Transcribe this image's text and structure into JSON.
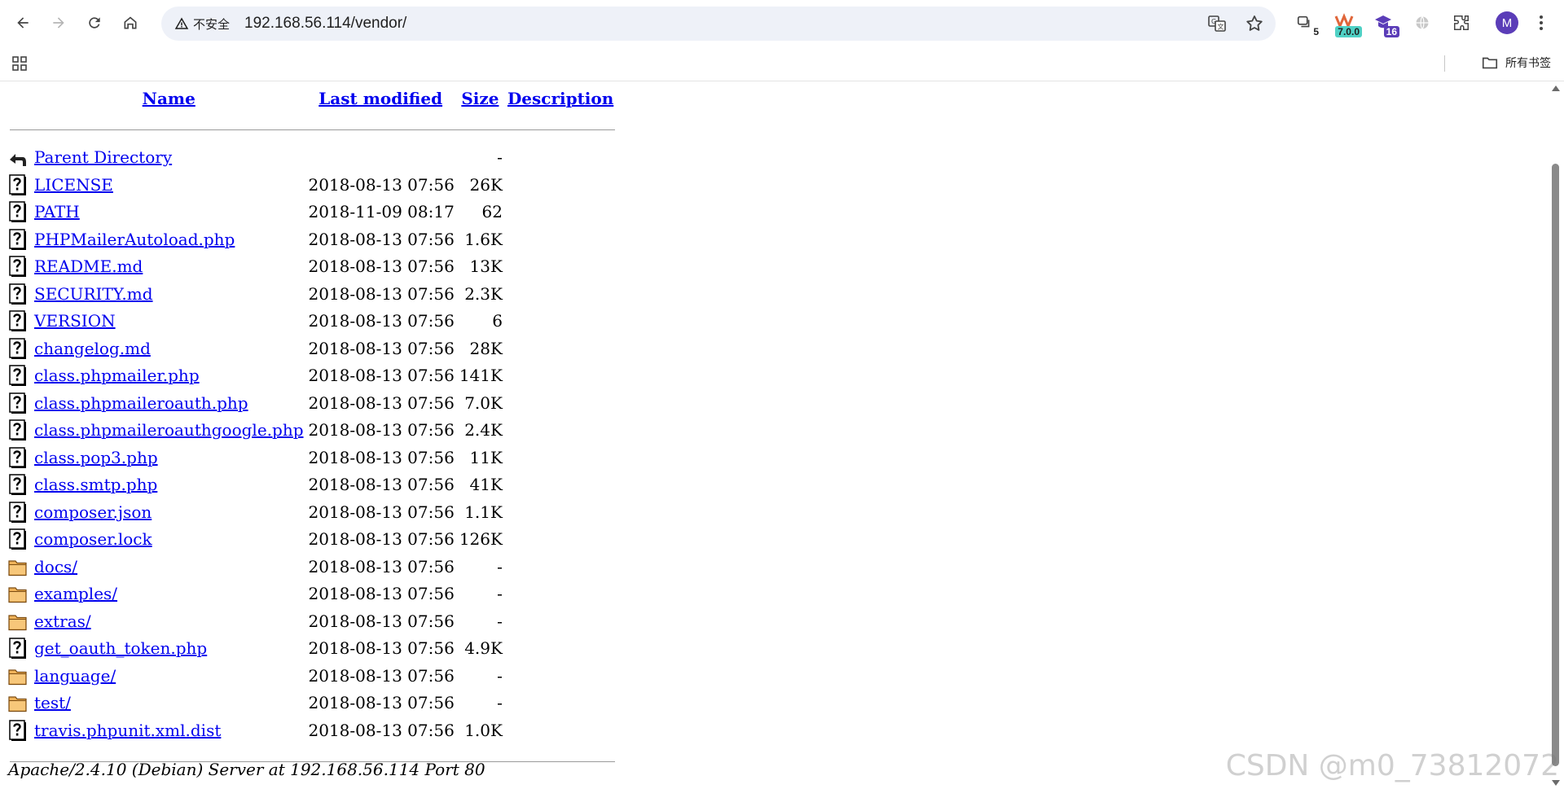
{
  "browser": {
    "security_label": "不安全",
    "url": "192.168.56.114/vendor/",
    "avatar_letter": "M",
    "bookmarks_label": "所有书签",
    "extensions": [
      {
        "icon": "tab-counter-icon",
        "badge": "5",
        "badge_color": "#1f1f1f"
      },
      {
        "icon": "wappalyzer-like-icon",
        "badge": "7.0.0",
        "badge_color": "#1b8f8a"
      },
      {
        "icon": "hat-icon",
        "badge": "16",
        "badge_color": "#5b3db8"
      },
      {
        "icon": "globe-icon",
        "badge": "",
        "badge_color": ""
      }
    ]
  },
  "listing": {
    "headers": {
      "name": "Name",
      "modified": "Last modified",
      "size": "Size",
      "description": "Description"
    },
    "rows": [
      {
        "icon": "parent-directory-icon",
        "name": "Parent Directory",
        "modified": "",
        "size": "-"
      },
      {
        "icon": "unknown-file-icon",
        "name": "LICENSE",
        "modified": "2018-08-13 07:56",
        "size": "26K"
      },
      {
        "icon": "unknown-file-icon",
        "name": "PATH",
        "modified": "2018-11-09 08:17",
        "size": "62"
      },
      {
        "icon": "unknown-file-icon",
        "name": "PHPMailerAutoload.php",
        "modified": "2018-08-13 07:56",
        "size": "1.6K"
      },
      {
        "icon": "unknown-file-icon",
        "name": "README.md",
        "modified": "2018-08-13 07:56",
        "size": "13K"
      },
      {
        "icon": "unknown-file-icon",
        "name": "SECURITY.md",
        "modified": "2018-08-13 07:56",
        "size": "2.3K"
      },
      {
        "icon": "unknown-file-icon",
        "name": "VERSION",
        "modified": "2018-08-13 07:56",
        "size": "6"
      },
      {
        "icon": "unknown-file-icon",
        "name": "changelog.md",
        "modified": "2018-08-13 07:56",
        "size": "28K"
      },
      {
        "icon": "unknown-file-icon",
        "name": "class.phpmailer.php",
        "modified": "2018-08-13 07:56",
        "size": "141K"
      },
      {
        "icon": "unknown-file-icon",
        "name": "class.phpmaileroauth.php",
        "modified": "2018-08-13 07:56",
        "size": "7.0K"
      },
      {
        "icon": "unknown-file-icon",
        "name": "class.phpmaileroauthgoogle.php",
        "modified": "2018-08-13 07:56",
        "size": "2.4K"
      },
      {
        "icon": "unknown-file-icon",
        "name": "class.pop3.php",
        "modified": "2018-08-13 07:56",
        "size": "11K"
      },
      {
        "icon": "unknown-file-icon",
        "name": "class.smtp.php",
        "modified": "2018-08-13 07:56",
        "size": "41K"
      },
      {
        "icon": "unknown-file-icon",
        "name": "composer.json",
        "modified": "2018-08-13 07:56",
        "size": "1.1K"
      },
      {
        "icon": "unknown-file-icon",
        "name": "composer.lock",
        "modified": "2018-08-13 07:56",
        "size": "126K"
      },
      {
        "icon": "folder-icon",
        "name": "docs/",
        "modified": "2018-08-13 07:56",
        "size": "-"
      },
      {
        "icon": "folder-icon",
        "name": "examples/",
        "modified": "2018-08-13 07:56",
        "size": "-"
      },
      {
        "icon": "folder-icon",
        "name": "extras/",
        "modified": "2018-08-13 07:56",
        "size": "-"
      },
      {
        "icon": "unknown-file-icon",
        "name": "get_oauth_token.php",
        "modified": "2018-08-13 07:56",
        "size": "4.9K"
      },
      {
        "icon": "folder-icon",
        "name": "language/",
        "modified": "2018-08-13 07:56",
        "size": "-"
      },
      {
        "icon": "folder-icon",
        "name": "test/",
        "modified": "2018-08-13 07:56",
        "size": "-"
      },
      {
        "icon": "unknown-file-icon",
        "name": "travis.phpunit.xml.dist",
        "modified": "2018-08-13 07:56",
        "size": "1.0K"
      }
    ]
  },
  "footer": {
    "address": "Apache/2.4.10 (Debian) Server at 192.168.56.114 Port 80"
  },
  "watermark": "CSDN @m0_73812072"
}
